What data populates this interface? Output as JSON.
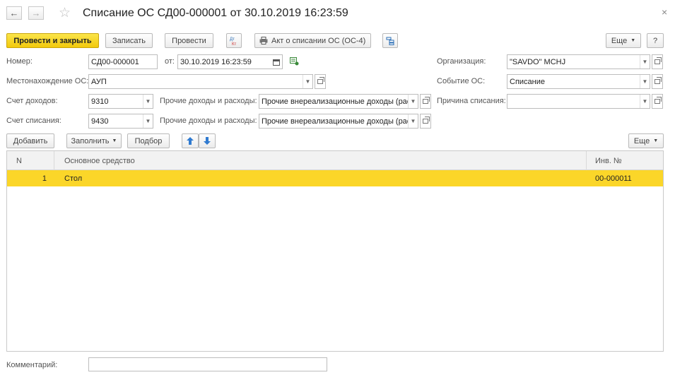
{
  "window": {
    "title": "Списание ОС СД00-000001 от 30.10.2019 16:23:59"
  },
  "toolbar": {
    "post_close": "Провести и закрыть",
    "save": "Записать",
    "post": "Провести",
    "dt_kt": "Дт Кт",
    "act": "Акт о списании ОС (ОС-4)",
    "more": "Еще",
    "help": "?"
  },
  "form": {
    "number_label": "Номер:",
    "number_value": "СД00-000001",
    "date_label": "от:",
    "date_value": "30.10.2019 16:23:59",
    "org_label": "Организация:",
    "org_value": "\"SAVDO\" MCHJ",
    "location_label": "Местонахождение ОС:",
    "location_value": "АУП",
    "event_label": "Событие ОС:",
    "event_value": "Списание",
    "income_account_label": "Счет доходов:",
    "income_account_value": "9310",
    "other_income_label": "Прочие доходы и расходы:",
    "other_income_value": "Прочие внереализационные доходы (рас",
    "reason_label": "Причина списания:",
    "reason_value": "",
    "writeoff_account_label": "Счет списания:",
    "writeoff_account_value": "9430",
    "other_expense_label": "Прочие доходы и расходы:",
    "other_expense_value": "Прочие внереализационные доходы (рас"
  },
  "table_toolbar": {
    "add": "Добавить",
    "fill": "Заполнить",
    "select": "Подбор",
    "more": "Еще"
  },
  "table": {
    "columns": [
      "N",
      "Основное средство",
      "Инв. №"
    ],
    "rows": [
      {
        "n": "1",
        "asset": "Стол",
        "inv": "00-000011"
      }
    ]
  },
  "footer": {
    "comment_label": "Комментарий:",
    "comment_value": ""
  },
  "colors": {
    "accent": "#f5d11a",
    "selected_row": "#fbd629"
  }
}
